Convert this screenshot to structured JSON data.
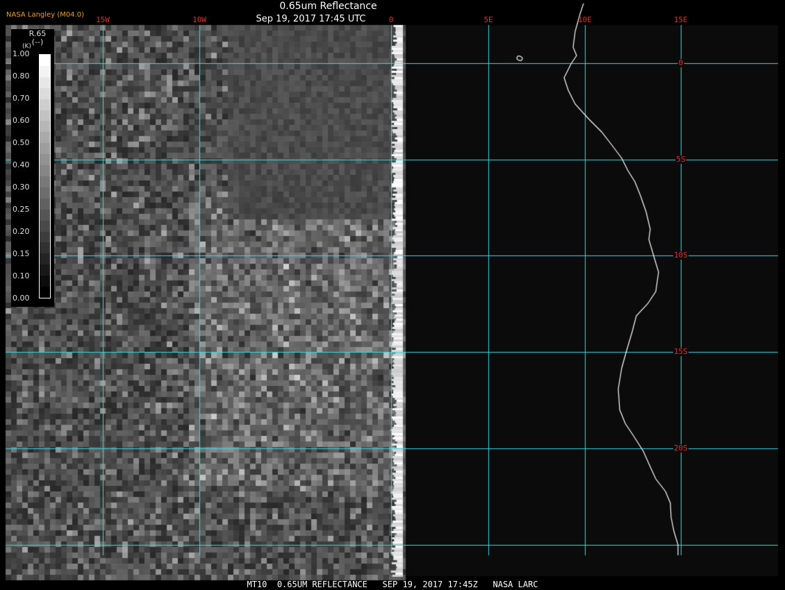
{
  "header": {
    "title": "0.65um Reflectance",
    "subtitle": "Sep 19, 2017 17:45 UTC",
    "brand": "NASA Langley (M04.0)"
  },
  "footer": {
    "caption": "MT10  0.65UM REFLECTANCE   SEP 19, 2017 17:45Z   NASA LARC"
  },
  "grid": {
    "longitudes": [
      {
        "label": "15W",
        "value": -15
      },
      {
        "label": "10W",
        "value": -10
      },
      {
        "label": "0",
        "value": 0
      },
      {
        "label": "5E",
        "value": 5
      },
      {
        "label": "10E",
        "value": 10
      },
      {
        "label": "15E",
        "value": 15
      }
    ],
    "latitudes": [
      {
        "label": "0",
        "value": 0
      },
      {
        "label": "5S",
        "value": -5
      },
      {
        "label": "10S",
        "value": -10
      },
      {
        "label": "15S",
        "value": -15
      },
      {
        "label": "20S",
        "value": -20
      }
    ],
    "line_color": "#40d8e0",
    "label_color": "#e0302a"
  },
  "legend": {
    "title": "R.65",
    "units": "(--)",
    "units_marker": "(K)",
    "ticks": [
      "1.00",
      "0.80",
      "0.70",
      "0.60",
      "0.50",
      "0.40",
      "0.30",
      "0.25",
      "0.20",
      "0.15",
      "0.10",
      "0.00"
    ]
  }
}
